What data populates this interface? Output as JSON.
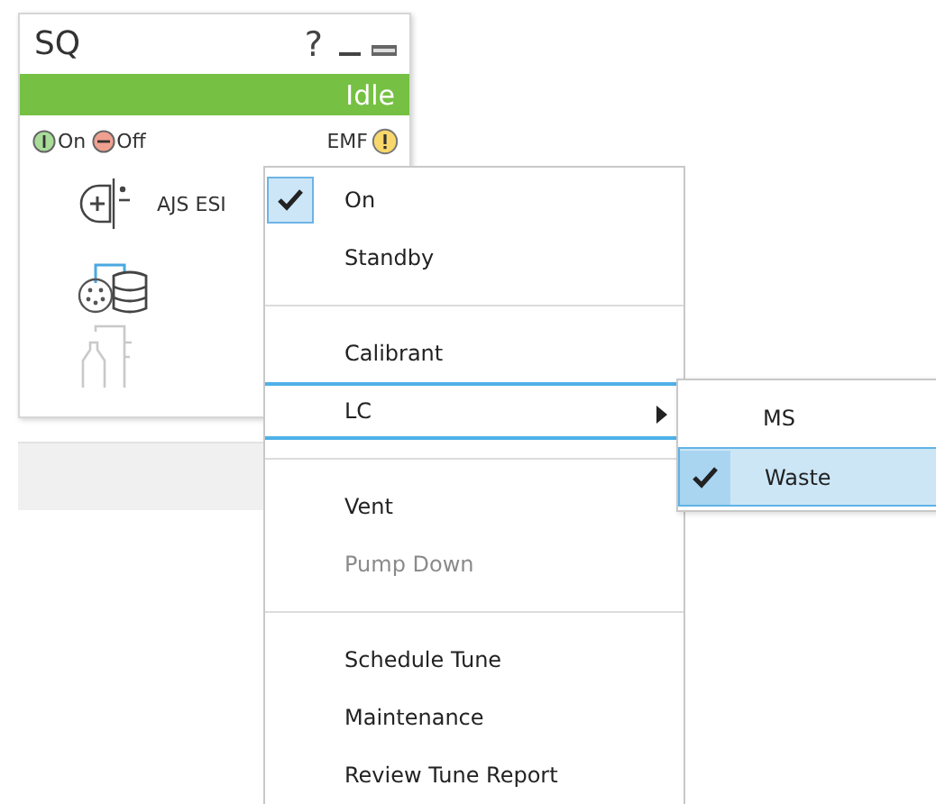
{
  "panel": {
    "title": "SQ",
    "help": "?",
    "status": "Idle",
    "legend": [
      {
        "label": "On",
        "kind": "on"
      },
      {
        "label": "Off",
        "kind": "off"
      }
    ],
    "emf": "EMF",
    "modules": [
      {
        "kind": "source",
        "label": "AJS ESI",
        "disabled": false
      },
      {
        "kind": "pump",
        "disabled": false
      },
      {
        "kind": "bottle",
        "disabled": true
      }
    ]
  },
  "menu": [
    {
      "kind": "item",
      "label": "On",
      "checked": true,
      "disabled": false,
      "selected": false,
      "submenu": false
    },
    {
      "kind": "item",
      "label": "Standby",
      "checked": false,
      "disabled": false,
      "selected": false,
      "submenu": false
    },
    {
      "kind": "separator"
    },
    {
      "kind": "item",
      "label": "Calibrant",
      "checked": false,
      "disabled": false,
      "selected": false,
      "submenu": false
    },
    {
      "kind": "item",
      "label": "LC",
      "checked": false,
      "disabled": false,
      "selected": true,
      "submenu": true
    },
    {
      "kind": "separator"
    },
    {
      "kind": "item",
      "label": "Vent",
      "checked": false,
      "disabled": false,
      "selected": false,
      "submenu": false
    },
    {
      "kind": "item",
      "label": "Pump Down",
      "checked": false,
      "disabled": true,
      "selected": false,
      "submenu": false
    },
    {
      "kind": "separator"
    },
    {
      "kind": "item",
      "label": "Schedule Tune",
      "checked": false,
      "disabled": false,
      "selected": false,
      "submenu": false
    },
    {
      "kind": "item",
      "label": "Maintenance",
      "checked": false,
      "disabled": false,
      "selected": false,
      "submenu": false
    },
    {
      "kind": "item",
      "label": "Review Tune Report",
      "checked": false,
      "disabled": false,
      "selected": false,
      "submenu": false
    }
  ],
  "submenu": [
    {
      "label": "MS",
      "checked": false,
      "selected": false
    },
    {
      "label": "Waste",
      "checked": true,
      "selected": true
    }
  ]
}
